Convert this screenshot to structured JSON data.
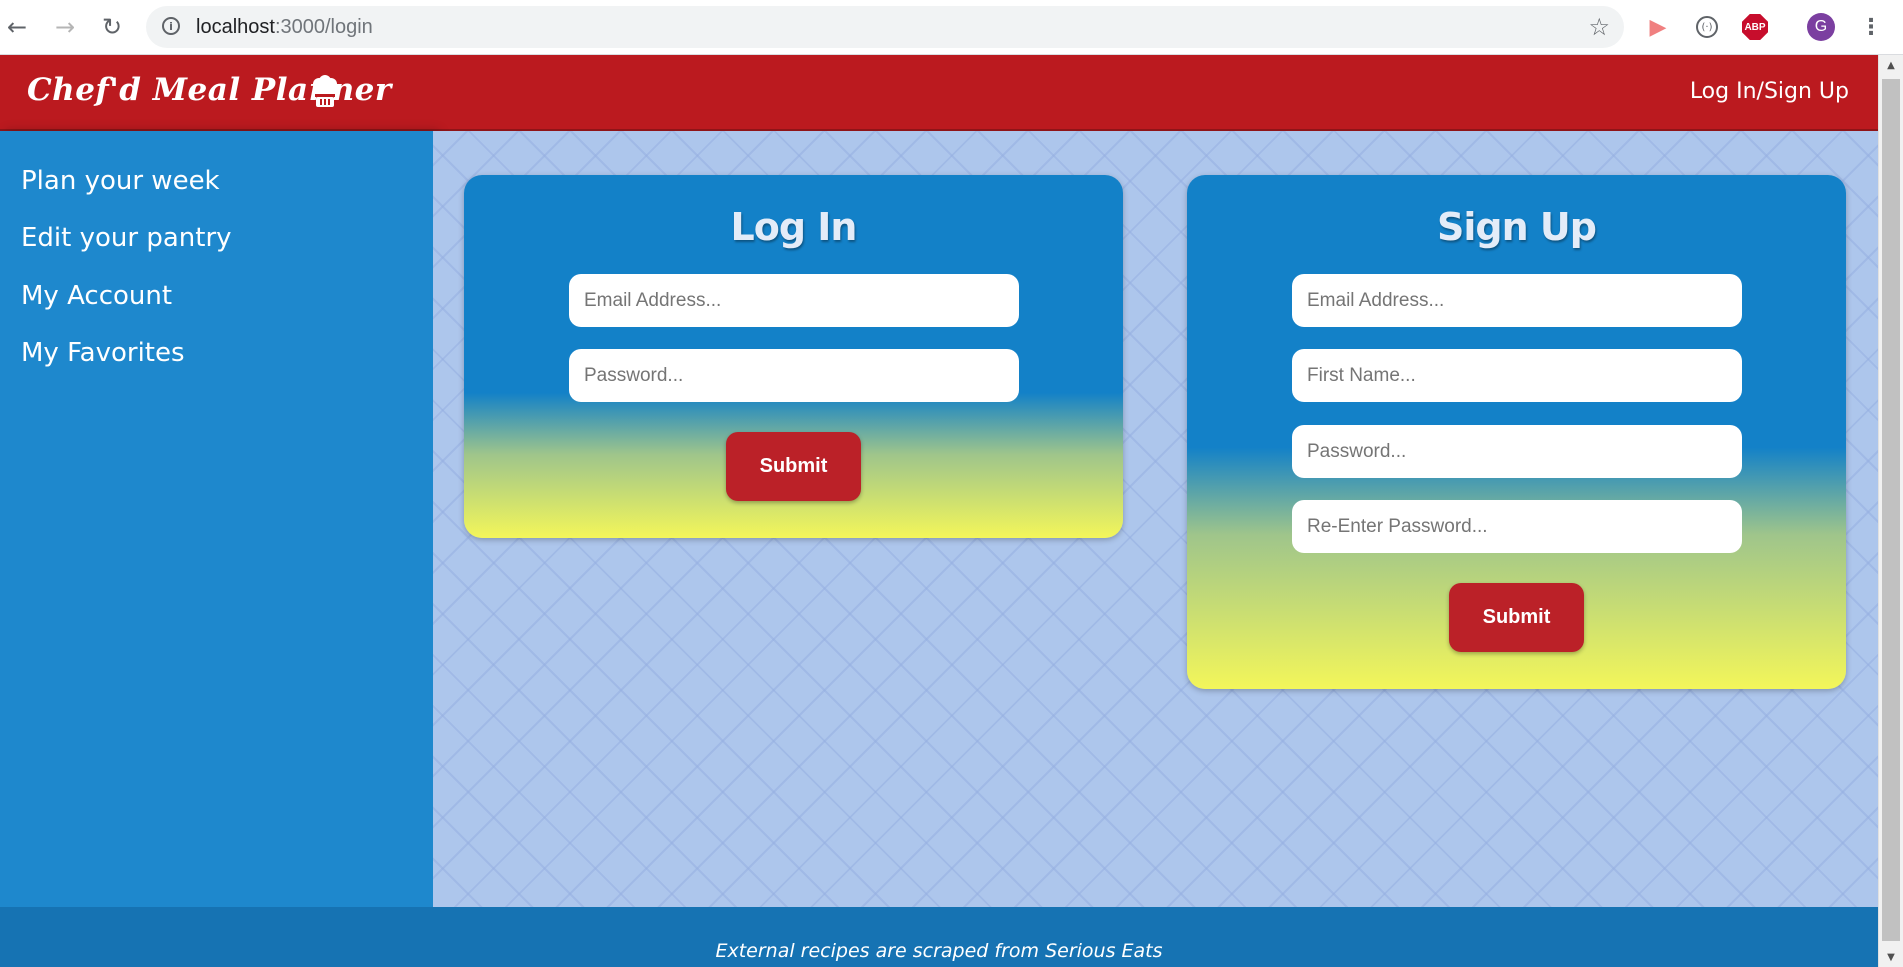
{
  "browser": {
    "url_host": "localhost",
    "url_path": ":3000/login",
    "avatar_letter": "G",
    "abp_label": "ABP"
  },
  "header": {
    "brand": "Chef'd Meal Planner",
    "login_link": "Log In/Sign Up"
  },
  "sidebar": {
    "items": [
      {
        "label": "Plan your week"
      },
      {
        "label": "Edit your pantry"
      },
      {
        "label": "My Account"
      },
      {
        "label": "My Favorites"
      }
    ]
  },
  "login": {
    "title": "Log In",
    "email_placeholder": "Email Address...",
    "password_placeholder": "Password...",
    "submit_label": "Submit"
  },
  "signup": {
    "title": "Sign Up",
    "email_placeholder": "Email Address...",
    "first_name_placeholder": "First Name...",
    "password_placeholder": "Password...",
    "reenter_password_placeholder": "Re-Enter Password...",
    "submit_label": "Submit"
  },
  "footer": {
    "text": "External recipes are scraped from Serious Eats"
  },
  "colors": {
    "header_red": "#bb1a1f",
    "sidebar_blue": "#1e88cd",
    "card_blue": "#1381c8",
    "card_yellow": "#f3f65a",
    "button_red": "#bb2128",
    "footer_blue": "#1673b3"
  },
  "icons": {
    "back": "arrow-left-icon",
    "forward": "arrow-right-icon",
    "reload": "reload-icon",
    "info": "info-icon",
    "star": "star-icon",
    "chef": "chef-hat-icon"
  }
}
